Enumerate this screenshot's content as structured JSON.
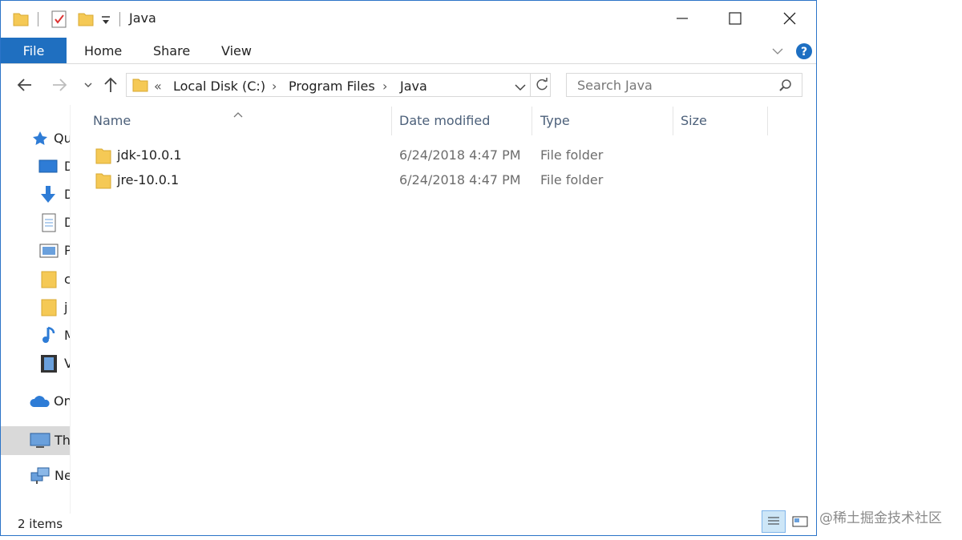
{
  "window": {
    "title": "Java"
  },
  "ribbon": {
    "file_label": "File",
    "tabs": [
      {
        "label": "Home"
      },
      {
        "label": "Share"
      },
      {
        "label": "View"
      }
    ]
  },
  "address": {
    "overflow": "«",
    "crumbs": [
      {
        "label": "Local Disk (C:)"
      },
      {
        "label": "Program Files"
      },
      {
        "label": "Java"
      }
    ],
    "separator": "›"
  },
  "search": {
    "placeholder": "Search Java"
  },
  "sidebar": {
    "items": [
      {
        "label": "Qu",
        "icon": "star-icon"
      },
      {
        "label": "D",
        "icon": "desktop-icon"
      },
      {
        "label": "D",
        "icon": "download-icon"
      },
      {
        "label": "D",
        "icon": "documents-icon"
      },
      {
        "label": "P",
        "icon": "pictures-icon"
      },
      {
        "label": "c",
        "icon": "folder-icon"
      },
      {
        "label": "j",
        "icon": "folder-icon"
      },
      {
        "label": "M",
        "icon": "music-icon"
      },
      {
        "label": "V",
        "icon": "videos-icon"
      },
      {
        "label": "On",
        "icon": "cloud-icon"
      },
      {
        "label": "Th",
        "icon": "computer-icon",
        "selected": true
      },
      {
        "label": "Ne",
        "icon": "network-icon"
      }
    ]
  },
  "columns": [
    {
      "label": "Name"
    },
    {
      "label": "Date modified"
    },
    {
      "label": "Type"
    },
    {
      "label": "Size"
    }
  ],
  "files": [
    {
      "name": "jdk-10.0.1",
      "date": "6/24/2018 4:47 PM",
      "type": "File folder",
      "size": ""
    },
    {
      "name": "jre-10.0.1",
      "date": "6/24/2018 4:47 PM",
      "type": "File folder",
      "size": ""
    }
  ],
  "status": {
    "item_count": "2 items"
  },
  "watermark": "@稀土掘金技术社区",
  "colors": {
    "accent": "#1f6fc0",
    "folder": "#f5c955",
    "help": "#1d6fc2"
  }
}
